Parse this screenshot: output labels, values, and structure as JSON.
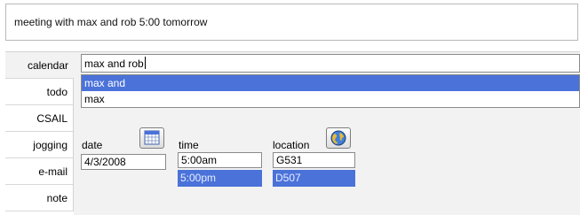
{
  "command": {
    "text": "meeting with max and rob 5:00 tomorrow"
  },
  "tabs": [
    {
      "label": "calendar",
      "selected": true
    },
    {
      "label": "todo",
      "selected": false
    },
    {
      "label": "CSAIL",
      "selected": false
    },
    {
      "label": "jogging",
      "selected": false
    },
    {
      "label": "e-mail",
      "selected": false
    },
    {
      "label": "note",
      "selected": false
    }
  ],
  "tag_input": {
    "value": "max and rob"
  },
  "autocomplete": [
    {
      "label": "max and",
      "selected": true
    },
    {
      "label": "max",
      "selected": false
    }
  ],
  "date": {
    "label": "date",
    "value": "4/3/2008",
    "icon": "calendar-icon"
  },
  "time": {
    "label": "time",
    "value": "5:00am",
    "option": "5:00pm"
  },
  "location": {
    "label": "location",
    "value": "G531",
    "option": "D507",
    "icon": "globe-icon"
  },
  "colors": {
    "selection": "#4a72d9",
    "panel": "#f2f2f2",
    "border": "#8a8a8a"
  }
}
